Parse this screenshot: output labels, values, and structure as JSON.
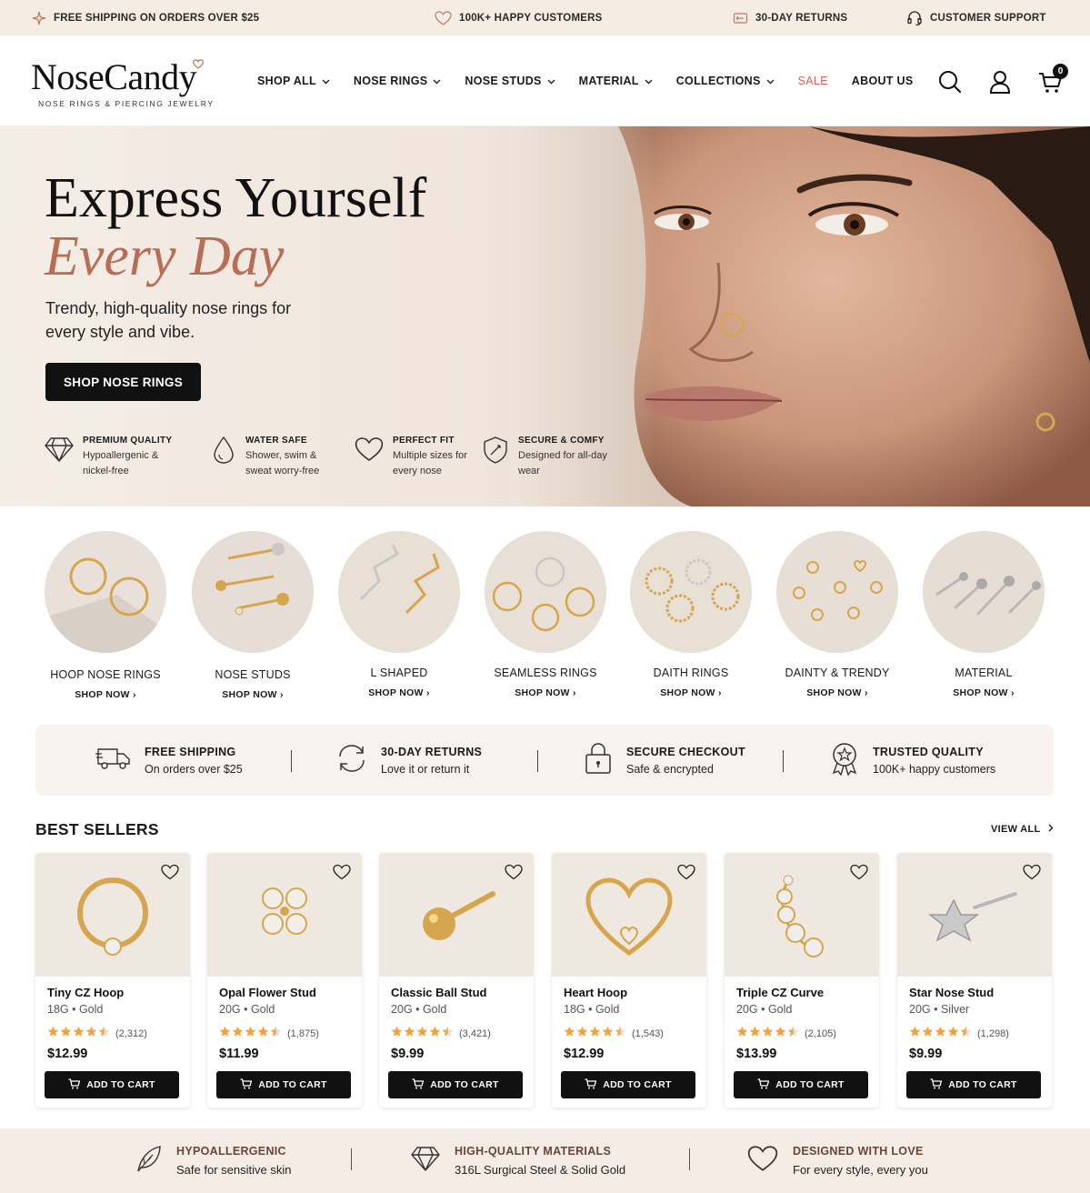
{
  "announcement": {
    "items": [
      {
        "label": "FREE SHIPPING ON ORDERS OVER $25",
        "icon": "sparkle-icon"
      },
      {
        "label": "100K+ HAPPY CUSTOMERS",
        "icon": "heart-icon"
      },
      {
        "label": "30-DAY RETURNS",
        "icon": "return-box-icon"
      },
      {
        "label": "CUSTOMER SUPPORT",
        "icon": "headset-icon"
      }
    ]
  },
  "header": {
    "logo": {
      "name": "NoseCandy",
      "tagline": "NOSE RINGS & PIERCING JEWELRY"
    },
    "nav": [
      {
        "label": "SHOP ALL",
        "dropdown": true
      },
      {
        "label": "NOSE RINGS",
        "dropdown": true
      },
      {
        "label": "NOSE STUDS",
        "dropdown": true
      },
      {
        "label": "MATERIAL",
        "dropdown": true
      },
      {
        "label": "COLLECTIONS",
        "dropdown": true
      },
      {
        "label": "SALE",
        "dropdown": false
      },
      {
        "label": "ABOUT US",
        "dropdown": false
      }
    ],
    "cart_count": "0",
    "colors": {
      "sale": "#d0645a",
      "accent": "#b86d55"
    }
  },
  "hero": {
    "title_line1": "Express Yourself",
    "title_line2": "Every Day",
    "subtitle": "Trendy, high-quality nose rings for every style and vibe.",
    "cta": "SHOP NOSE RINGS",
    "features": [
      {
        "title": "PREMIUM QUALITY",
        "desc": "Hypoallergenic & nickel-free",
        "icon": "diamond-icon"
      },
      {
        "title": "WATER SAFE",
        "desc": "Shower, swim & sweat worry-free",
        "icon": "water-drop-icon"
      },
      {
        "title": "PERFECT FIT",
        "desc": "Multiple sizes for every nose",
        "icon": "heart-icon"
      },
      {
        "title": "SECURE & COMFY",
        "desc": "Designed for all-day wear",
        "icon": "shield-icon"
      }
    ]
  },
  "categories": [
    {
      "label": "HOOP NOSE RINGS",
      "cta": "SHOP NOW"
    },
    {
      "label": "NOSE STUDS",
      "cta": "SHOP NOW"
    },
    {
      "label": "L SHAPED",
      "cta": "SHOP NOW"
    },
    {
      "label": "SEAMLESS RINGS",
      "cta": "SHOP NOW"
    },
    {
      "label": "DAITH RINGS",
      "cta": "SHOP NOW"
    },
    {
      "label": "DAINTY & TRENDY",
      "cta": "SHOP NOW"
    },
    {
      "label": "MATERIAL",
      "cta": "SHOP NOW"
    }
  ],
  "benefits": [
    {
      "title": "FREE SHIPPING",
      "desc": "On orders over $25",
      "icon": "truck-icon"
    },
    {
      "title": "30-DAY RETURNS",
      "desc": "Love it or return it",
      "icon": "refresh-icon"
    },
    {
      "title": "SECURE CHECKOUT",
      "desc": "Safe & encrypted",
      "icon": "lock-icon"
    },
    {
      "title": "TRUSTED QUALITY",
      "desc": "100K+ happy customers",
      "icon": "award-badge-icon"
    }
  ],
  "best_sellers": {
    "heading": "BEST SELLERS",
    "view_all": "VIEW ALL",
    "add_to_cart": "ADD TO CART",
    "products": [
      {
        "name": "Tiny CZ Hoop",
        "variant": "18G • Gold",
        "rating": 4.5,
        "reviews": "(2,312)",
        "price": "$12.99"
      },
      {
        "name": "Opal Flower Stud",
        "variant": "20G • Gold",
        "rating": 4.5,
        "reviews": "(1,875)",
        "price": "$11.99"
      },
      {
        "name": "Classic Ball Stud",
        "variant": "20G • Gold",
        "rating": 4.5,
        "reviews": "(3,421)",
        "price": "$9.99"
      },
      {
        "name": "Heart Hoop",
        "variant": "18G • Gold",
        "rating": 4.5,
        "reviews": "(1,543)",
        "price": "$12.99"
      },
      {
        "name": "Triple CZ Curve",
        "variant": "20G • Gold",
        "rating": 4.5,
        "reviews": "(2,105)",
        "price": "$13.99"
      },
      {
        "name": "Star Nose Stud",
        "variant": "20G • Silver",
        "rating": 4.5,
        "reviews": "(1,298)",
        "price": "$9.99"
      }
    ]
  },
  "footer_strip": [
    {
      "title": "HYPOALLERGENIC",
      "desc": "Safe for sensitive skin",
      "icon": "leaf-icon"
    },
    {
      "title": "HIGH-QUALITY MATERIALS",
      "desc": "316L Surgical Steel & Solid Gold",
      "icon": "diamond-icon"
    },
    {
      "title": "DESIGNED WITH LOVE",
      "desc": "For every style, every you",
      "icon": "heart-icon"
    }
  ]
}
